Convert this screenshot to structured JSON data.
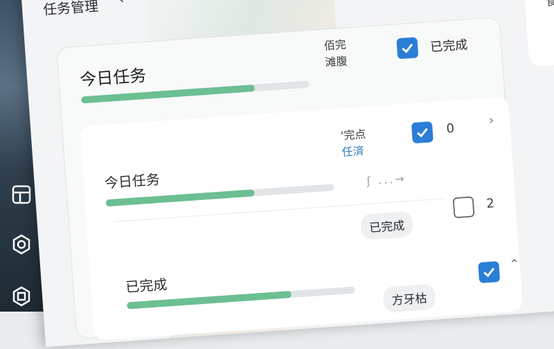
{
  "header": {
    "title": "任务管理"
  },
  "side_card": {
    "label": "食"
  },
  "today_card": {
    "title": "今日任务",
    "progress": 0.76,
    "status_top": "佰完",
    "status_bottom": "滩腹",
    "checkbox_checked": true,
    "checkbox_label": "已完成"
  },
  "rows": [
    {
      "title": "今日任务",
      "progress": 0.65,
      "status_top": "'完点",
      "status_link": "任済",
      "checkbox_checked": true,
      "count": "0",
      "flow_text": "ʃ ...→"
    },
    {
      "pill": "已完成",
      "checkbox_checked": false,
      "count": "2"
    },
    {
      "title": "已完成",
      "progress": 0.72,
      "pill": "方牙枯",
      "checkbox_checked": true,
      "arrow": "⌃"
    }
  ]
}
